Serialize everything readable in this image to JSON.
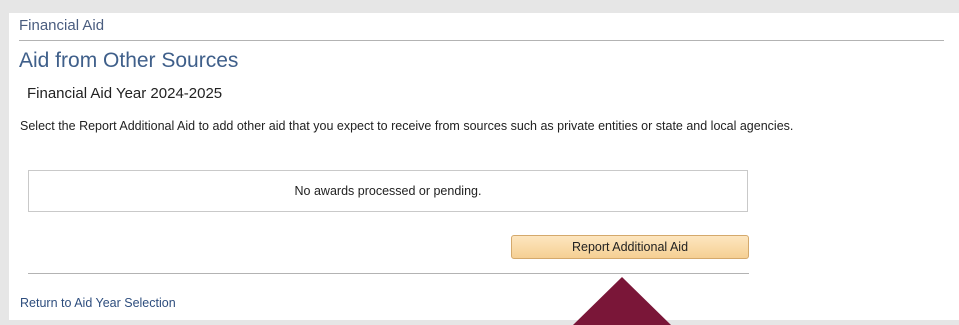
{
  "breadcrumb": "Financial Aid",
  "page_title": "Aid from Other Sources",
  "aid_year": "Financial Aid Year 2024-2025",
  "instructions": "Select the Report Additional Aid to add other aid that you expect to receive from sources such as private entities or state and local agencies.",
  "awards_message": "No awards processed or pending.",
  "report_button_label": "Report Additional Aid",
  "return_link_label": "Return to Aid Year Selection",
  "colors": {
    "title": "#3f5f8a",
    "button": "#f9dba9",
    "arrow": "#7a1638",
    "link": "#2e4e7e"
  }
}
